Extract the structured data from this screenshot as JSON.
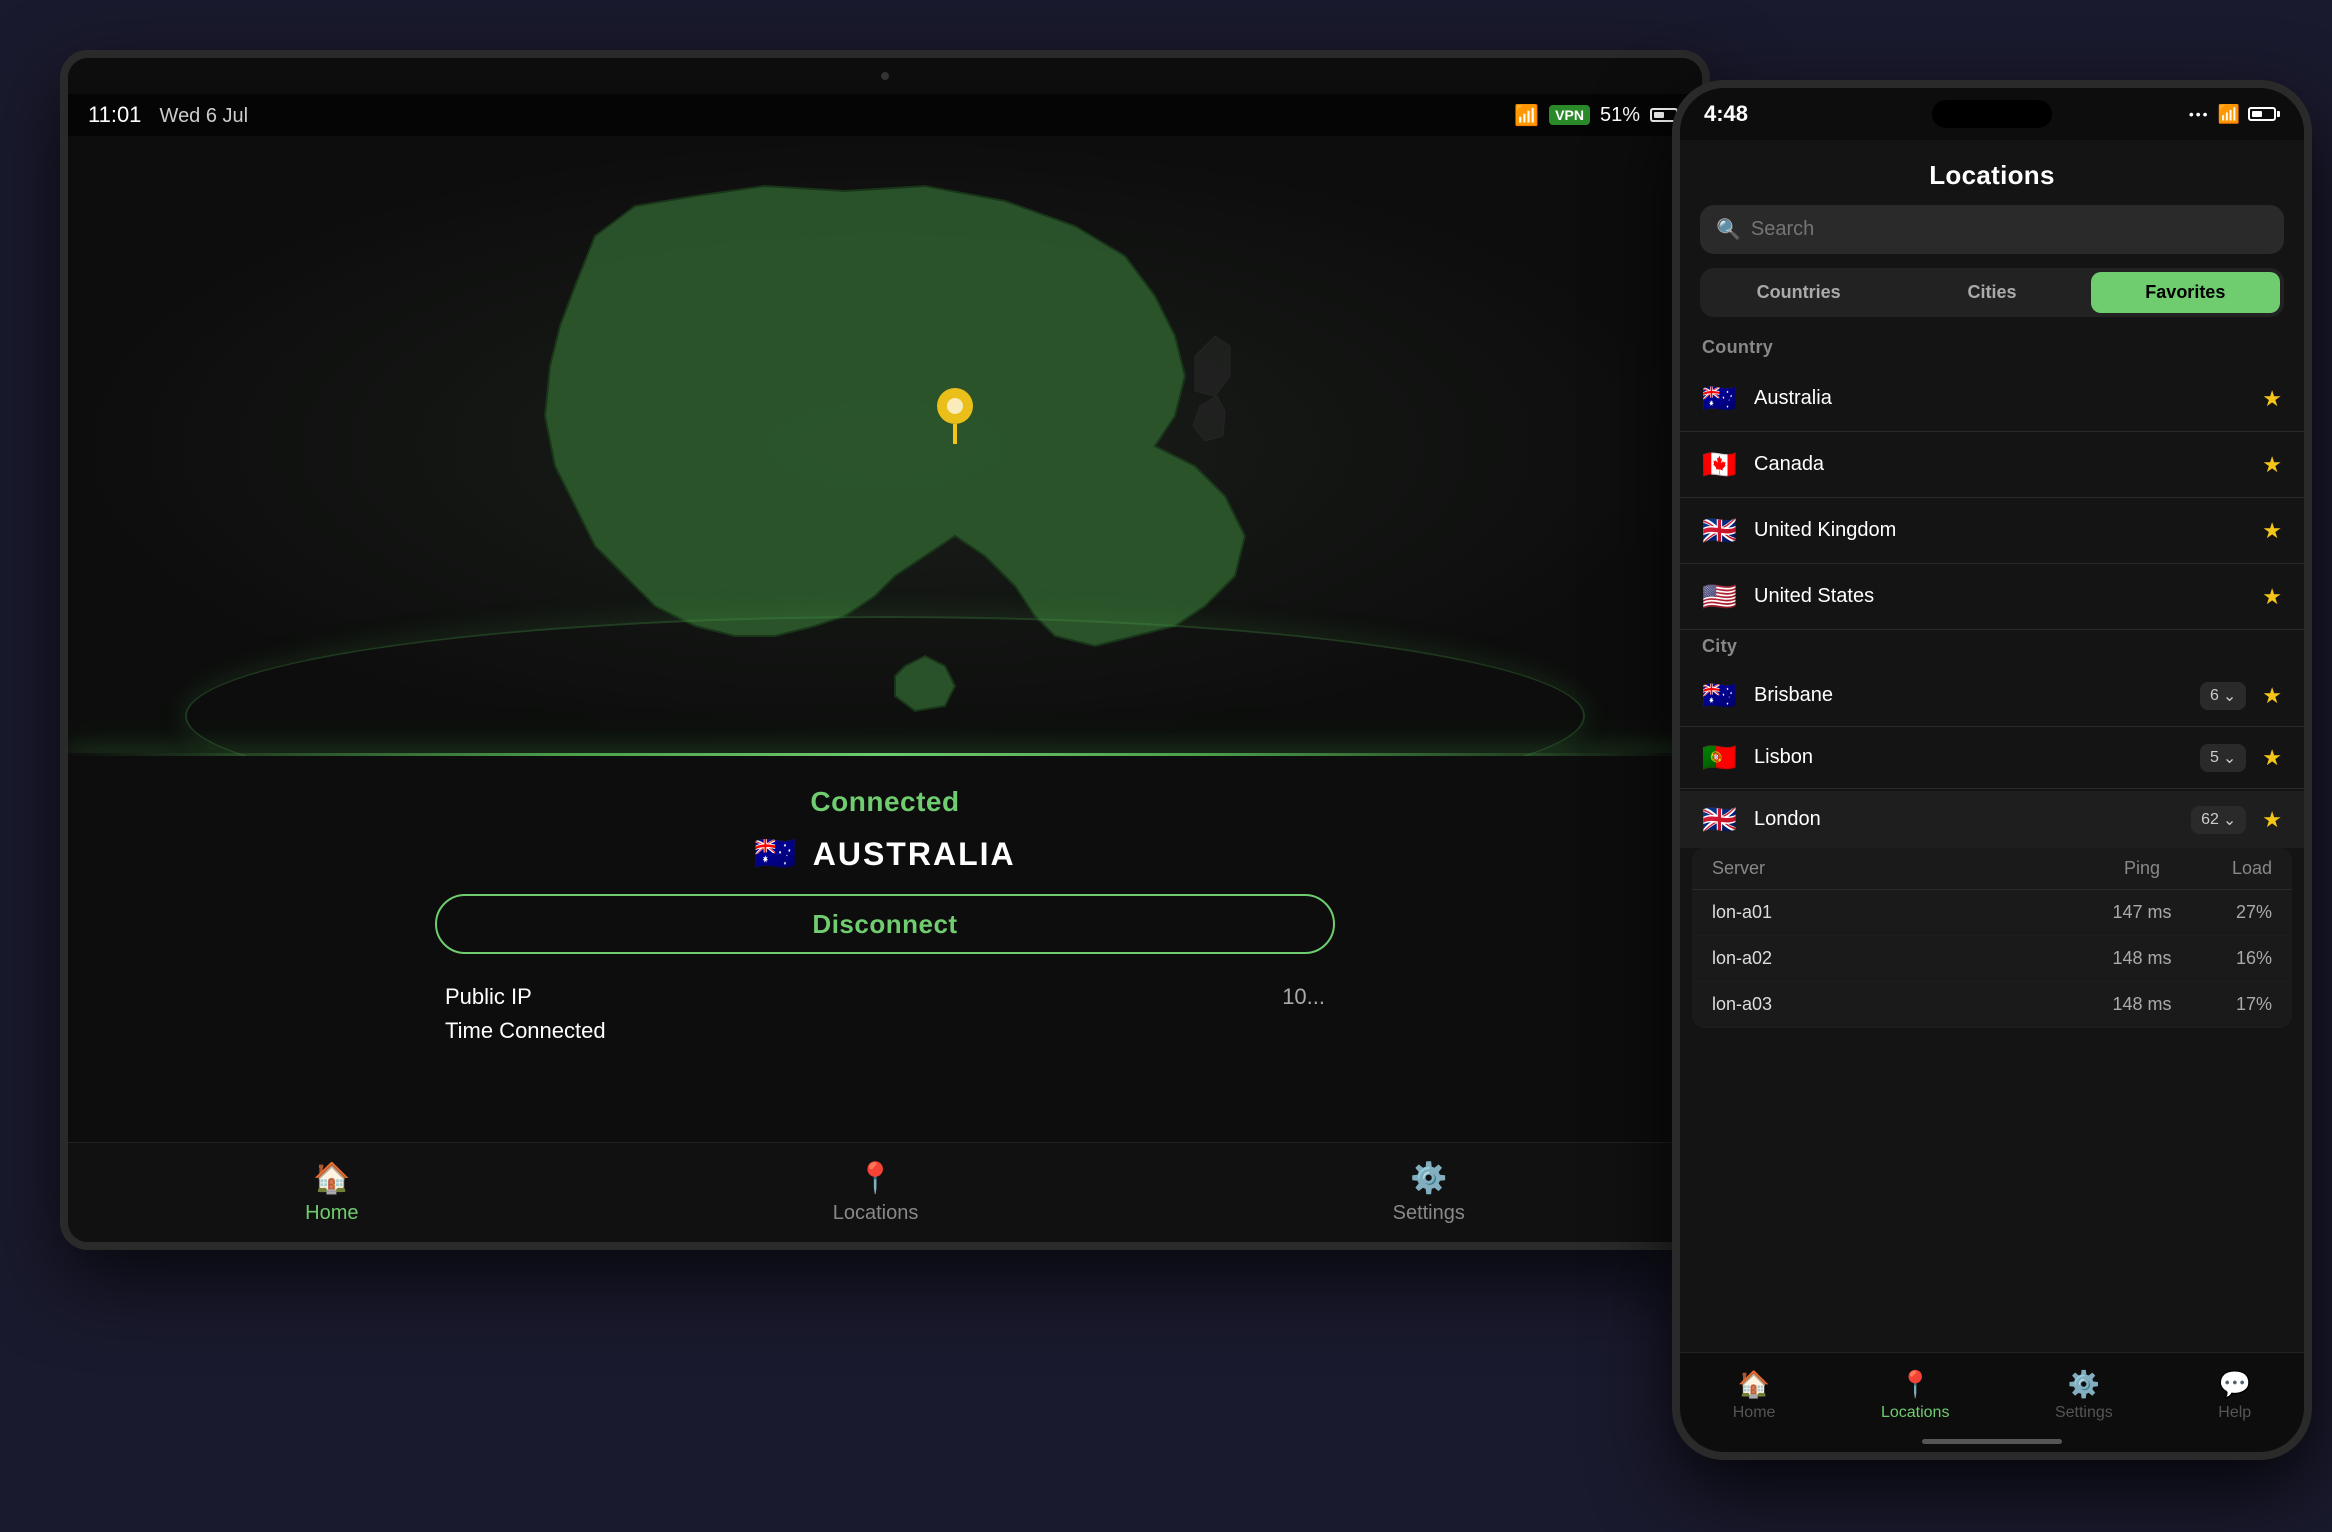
{
  "background_color": "#1a1a2e",
  "tablet": {
    "status_bar": {
      "time": "11:01",
      "date": "Wed 6 Jul",
      "signal_icon": "wifi-icon",
      "vpn_label": "VPN",
      "battery_percent": "51%",
      "battery_icon": "battery-icon"
    },
    "map": {
      "country": "Australia",
      "pin_icon": "map-pin-icon"
    },
    "connection": {
      "status": "Connected",
      "country_label": "AUSTRALIA",
      "country_flag": "🇦🇺",
      "disconnect_button": "Disconnect",
      "public_ip_label": "Public IP",
      "public_ip_value": "10...",
      "time_connected_label": "Time Connected",
      "time_connected_value": ""
    },
    "nav": {
      "items": [
        {
          "icon": "home-icon",
          "label": "Home",
          "active": false
        },
        {
          "icon": "location-icon",
          "label": "Locations",
          "active": false
        },
        {
          "icon": "settings-icon",
          "label": "Settings",
          "active": false
        }
      ]
    }
  },
  "phone": {
    "status_bar": {
      "time": "4:48",
      "info_icon": "info-icon",
      "signal_bars": "wifi-icon",
      "battery_icon": "battery-icon"
    },
    "header": {
      "title": "Locations"
    },
    "search": {
      "placeholder": "Search"
    },
    "tabs": [
      {
        "label": "Countries",
        "active": false
      },
      {
        "label": "Cities",
        "active": false
      },
      {
        "label": "Favorites",
        "active": true
      }
    ],
    "country_section": {
      "heading": "Country",
      "items": [
        {
          "flag": "🇦🇺",
          "name": "Australia",
          "favorite": true
        },
        {
          "flag": "🇨🇦",
          "name": "Canada",
          "favorite": true
        },
        {
          "flag": "🇬🇧",
          "name": "United Kingdom",
          "favorite": true
        },
        {
          "flag": "🇺🇸",
          "name": "United States",
          "favorite": true
        }
      ]
    },
    "city_section": {
      "heading": "City",
      "items": [
        {
          "flag": "🇦🇺",
          "name": "Brisbane",
          "server_count": "6",
          "favorite": true
        },
        {
          "flag": "🇵🇹",
          "name": "Lisbon",
          "server_count": "5",
          "favorite": true
        },
        {
          "flag": "🇬🇧",
          "name": "London",
          "server_count": "62",
          "favorite": true,
          "expanded": true
        }
      ]
    },
    "server_table": {
      "headers": [
        "Server",
        "Ping",
        "Load"
      ],
      "rows": [
        {
          "name": "lon-a01",
          "ping": "147 ms",
          "load": "27%"
        },
        {
          "name": "lon-a02",
          "ping": "148 ms",
          "load": "16%"
        },
        {
          "name": "lon-a03",
          "ping": "148 ms",
          "load": "17%"
        }
      ]
    },
    "nav": {
      "items": [
        {
          "icon": "home-icon",
          "label": "Home",
          "active": false
        },
        {
          "icon": "location-icon",
          "label": "Locations",
          "active": true
        },
        {
          "icon": "settings-icon",
          "label": "Settings",
          "active": false
        },
        {
          "icon": "help-icon",
          "label": "Help",
          "active": false
        }
      ]
    }
  }
}
